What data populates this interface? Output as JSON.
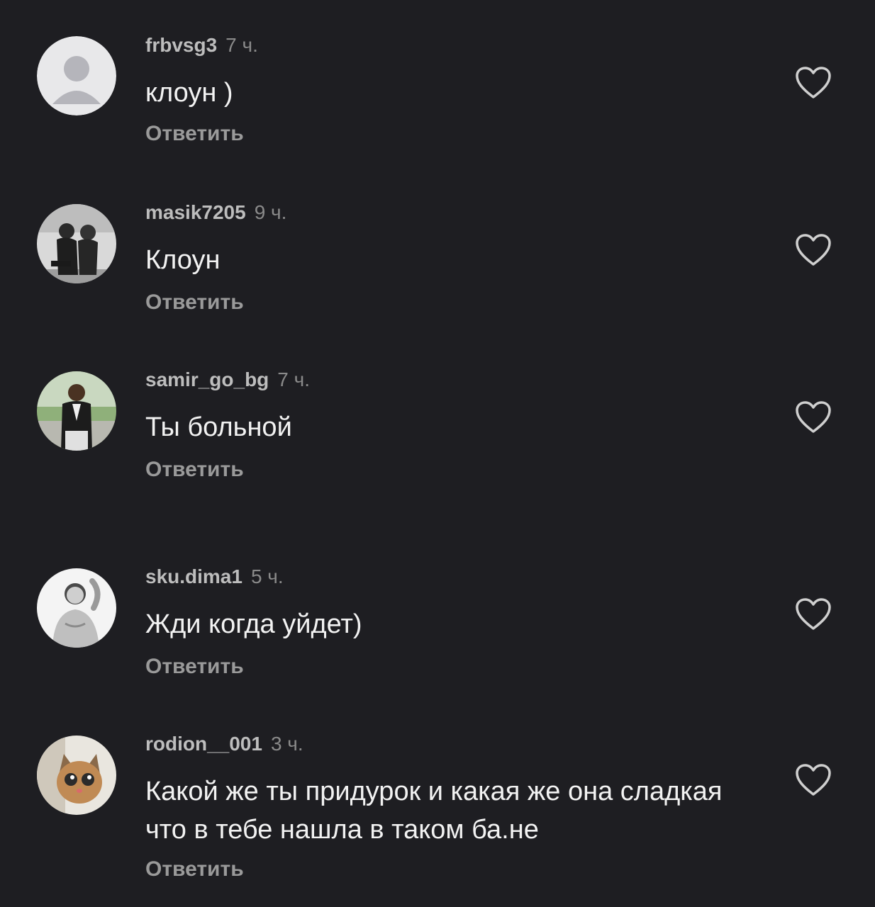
{
  "comments": [
    {
      "username": "frbvsg3",
      "time": "7 ч.",
      "text": "клоун )",
      "reply_label": "Ответить",
      "avatar_icon": "default-user-icon"
    },
    {
      "username": "masik7205",
      "time": "9 ч.",
      "text": "Клоун",
      "reply_label": "Ответить",
      "avatar_icon": "photo-avatar"
    },
    {
      "username": "samir_go_bg",
      "time": "7 ч.",
      "text": "Ты больной",
      "reply_label": "Ответить",
      "avatar_icon": "photo-avatar"
    },
    {
      "username": "sku.dima1",
      "time": "5 ч.",
      "text": "Жди когда уйдет)",
      "reply_label": "Ответить",
      "avatar_icon": "photo-avatar"
    },
    {
      "username": "rodion__001",
      "time": "3 ч.",
      "text": "Какой же ты придурок и какая же она сладкая что в тебе нашла в таком ба.не",
      "reply_label": "Ответить",
      "avatar_icon": "cat-photo-avatar"
    }
  ],
  "colors": {
    "background": "#1e1e22",
    "username": "#bdbdbd",
    "time": "#8a8a8a",
    "text": "#f2f2f2",
    "reply": "#9a9a9a",
    "like_icon": "#cfcfcf"
  },
  "like_icon": "heart-outline-icon"
}
